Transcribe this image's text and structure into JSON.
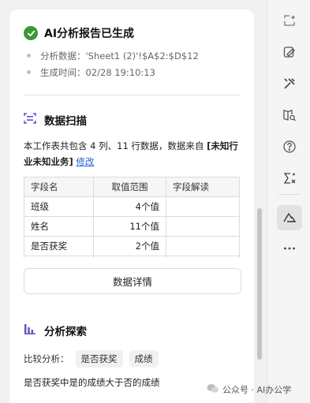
{
  "report": {
    "title": "AI分析报告已生成",
    "data_line": "分析数据：'Sheet1 (2)'!$A$2:$D$12",
    "time_line": "生成时间：02/28 19:10:13"
  },
  "scan": {
    "title": "数据扫描",
    "desc_prefix": "本工作表共包含 4 列、11 行数据，数据来自 ",
    "desc_bold": "[未知行业未知业务]",
    "edit_link": "修改",
    "columns": [
      "字段名",
      "取值范围",
      "字段解读"
    ],
    "rows": [
      {
        "name": "班级",
        "range": "4个值",
        "note": ""
      },
      {
        "name": "姓名",
        "range": "11个值",
        "note": ""
      },
      {
        "name": "是否获奖",
        "range": "2个值",
        "note": ""
      },
      {
        "name": "",
        "range": "",
        "note": ""
      }
    ],
    "details_button": "数据详情"
  },
  "explore": {
    "title": "分析探索",
    "compare_label": "比较分析：",
    "chips": [
      "是否获奖",
      "成绩"
    ],
    "finding": "是否获奖中是的成绩大于否的成绩"
  },
  "watermark": "公众号 · AI办公学",
  "colors": {
    "success": "#3a9a35",
    "accent": "#6a4bc4",
    "link": "#2b63d6"
  },
  "icons": {
    "rail": [
      "transform-icon",
      "sheet-pen-icon",
      "tools-icon",
      "book-search-icon",
      "help-icon",
      "formula-icon",
      "ai-analysis-icon",
      "more-icon"
    ]
  }
}
